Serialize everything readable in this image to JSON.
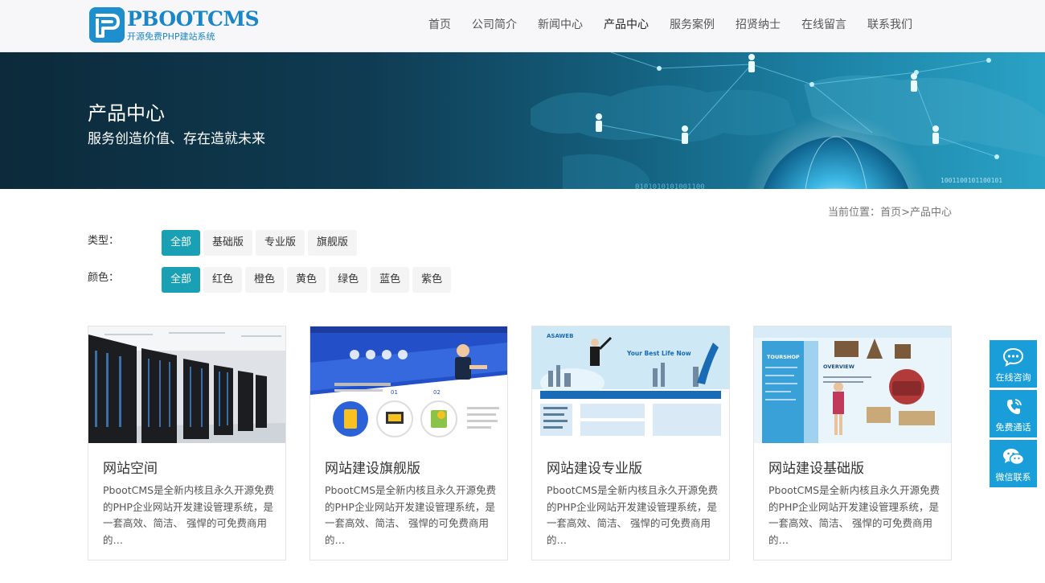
{
  "header": {
    "logo_name": "PBOOTCMS",
    "logo_tagline": "开源免费PHP建站系统",
    "nav": [
      {
        "label": "首页"
      },
      {
        "label": "公司简介"
      },
      {
        "label": "新闻中心"
      },
      {
        "label": "产品中心"
      },
      {
        "label": "服务案例"
      },
      {
        "label": "招贤纳士"
      },
      {
        "label": "在线留言"
      },
      {
        "label": "联系我们"
      }
    ],
    "active_nav": "产品中心"
  },
  "banner": {
    "title": "产品中心",
    "subtitle": "服务创造价值、存在造就未来",
    "binary_text_1": "0101010101001100",
    "binary_text_2": "1001100101100101"
  },
  "breadcrumb": {
    "prefix": "当前位置：",
    "home": "首页",
    "separator": ">",
    "current": "产品中心"
  },
  "filters": {
    "type_label": "类型：",
    "type_options": [
      "全部",
      "基础版",
      "专业版",
      "旗舰版"
    ],
    "color_label": "颜色：",
    "color_options": [
      "全部",
      "红色",
      "橙色",
      "黄色",
      "绿色",
      "蓝色",
      "紫色"
    ],
    "selected_type": "全部",
    "selected_color": "全部"
  },
  "products": [
    {
      "title": "网站空间",
      "desc": "PbootCMS是全新内核且永久开源免费的PHP企业网站开发建设管理系统，是一套高效、简洁、 强悍的可免费商用的…",
      "image": "server-room"
    },
    {
      "title": "网站建设旗舰版",
      "desc": "PbootCMS是全新内核且永久开源免费的PHP企业网站开发建设管理系统，是一套高效、简洁、 强悍的可免费商用的…",
      "image": "flagship-web-template",
      "image_text": {
        "step1": "01",
        "step2": "02"
      }
    },
    {
      "title": "网站建设专业版",
      "desc": "PbootCMS是全新内核且永久开源免费的PHP企业网站开发建设管理系统，是一套高效、简洁、 强悍的可免费商用的…",
      "image": "professional-web-template",
      "image_text": {
        "brand": "ASAWEB",
        "headline": "Your Best Life Now"
      }
    },
    {
      "title": "网站建设基础版",
      "desc": "PbootCMS是全新内核且永久开源免费的PHP企业网站开发建设管理系统，是一套高效、简洁、 强悍的可免费商用的…",
      "image": "basic-web-template",
      "image_text": {
        "brand": "TOURSHOP",
        "heading": "OVERVIEW"
      }
    }
  ],
  "side_widgets": [
    {
      "label": "在线咨询",
      "icon": "chat-icon"
    },
    {
      "label": "免费通话",
      "icon": "phone-icon"
    },
    {
      "label": "微信联系",
      "icon": "wechat-icon"
    }
  ],
  "colors": {
    "accent": "#1aa0b4",
    "brand": "#1a86c8",
    "side_widget": "#1a9ed9"
  }
}
